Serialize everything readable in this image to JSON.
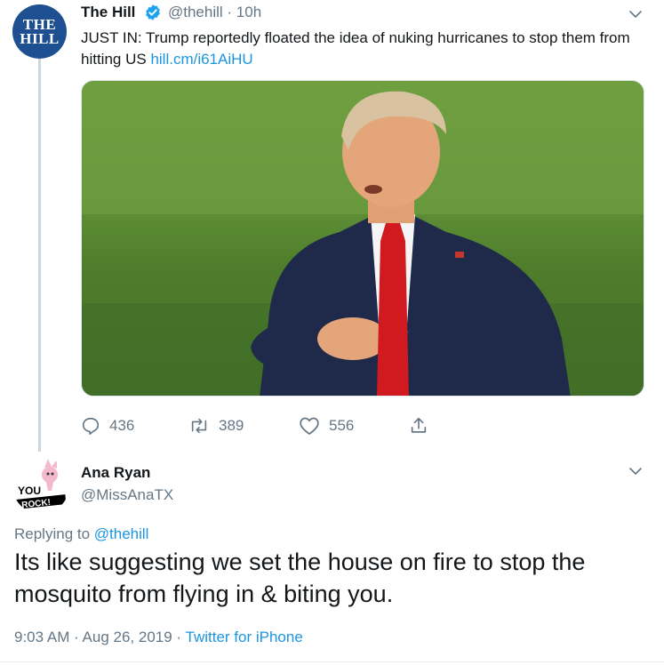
{
  "tweet": {
    "avatar_text": [
      "THE",
      "HILL"
    ],
    "name": "The Hill",
    "handle_time": "@thehill · 10h",
    "text": "JUST IN: Trump reportedly floated the idea of nuking hurricanes to stop them from hitting US ",
    "link": "hill.cm/i61AiHU",
    "actions": {
      "reply_count": "436",
      "retweet_count": "389",
      "like_count": "556"
    }
  },
  "reply": {
    "name": "Ana Ryan",
    "handle": "@MissAnaTX",
    "replying_prefix": "Replying to ",
    "replying_handle": "@thehill",
    "text": "Its like suggesting we set the house on fire to stop the mosquito from flying in & biting you.",
    "time": "9:03 AM · Aug 26, 2019 · ",
    "source": "Twitter for iPhone",
    "avatar_text": [
      "YOU",
      "ROCK!"
    ]
  },
  "colors": {
    "link": "#1b95e0",
    "muted": "#657786",
    "hill_blue": "#1d4f91"
  }
}
